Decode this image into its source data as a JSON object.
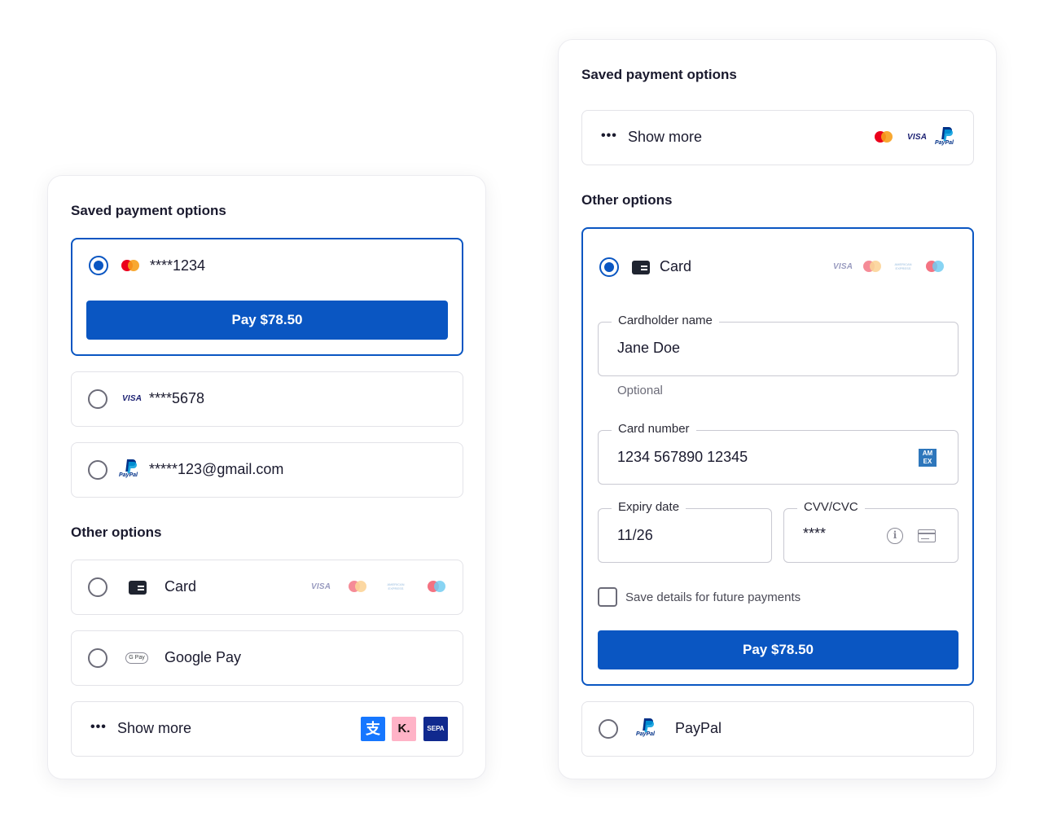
{
  "colors": {
    "primary": "#0a56c2",
    "text": "#1a1a2e",
    "border": "#e3e3e8",
    "muted": "#6b6b78"
  },
  "left": {
    "saved_heading": "Saved payment options",
    "saved": [
      {
        "label": "****1234",
        "logo": "mastercard-icon",
        "selected": true
      },
      {
        "label": "****5678",
        "logo": "visa-icon",
        "selected": false
      },
      {
        "label": "*****123@gmail.com",
        "logo": "paypal-icon",
        "selected": false
      }
    ],
    "visa_text": "VISA",
    "paypal_text": "PayPal",
    "pay_label": "Pay $78.50",
    "other_heading": "Other options",
    "card": {
      "label": "Card",
      "brands": [
        "visa-icon",
        "mastercard-icon",
        "amex-icon",
        "maestro-icon"
      ],
      "visa_text": "VISA",
      "amex_text": "AMERICAN EXPRESS"
    },
    "google_pay": {
      "label": "Google Pay",
      "badge_text": "G Pay"
    },
    "show_more": {
      "label": "Show more",
      "tiles": [
        "alipay-icon",
        "klarna-icon",
        "sepa-icon"
      ],
      "klarna_text": "K.",
      "alipay_text": "支",
      "sepa_text": "SEPA"
    }
  },
  "right": {
    "saved_heading": "Saved payment options",
    "show_more": {
      "label": "Show more",
      "brands": [
        "mastercard-icon",
        "visa-icon",
        "paypal-icon"
      ],
      "visa_text": "VISA",
      "paypal_text": "PayPal"
    },
    "other_heading": "Other options",
    "card": {
      "label": "Card",
      "visa_text": "VISA",
      "amex_text": "AMERICAN EXPRESS",
      "cardholder": {
        "label": "Cardholder name",
        "value": "Jane Doe",
        "hint": "Optional"
      },
      "number": {
        "label": "Card number",
        "value": "1234 567890 12345",
        "badge": "AM EX"
      },
      "expiry": {
        "label": "Expiry date",
        "value": "11/26"
      },
      "cvv": {
        "label": "CVV/CVC",
        "value": "****"
      },
      "save_details": "Save details for future payments",
      "pay_label": "Pay $78.50"
    },
    "paypal": {
      "label": "PayPal",
      "logo_text": "PayPal"
    }
  }
}
